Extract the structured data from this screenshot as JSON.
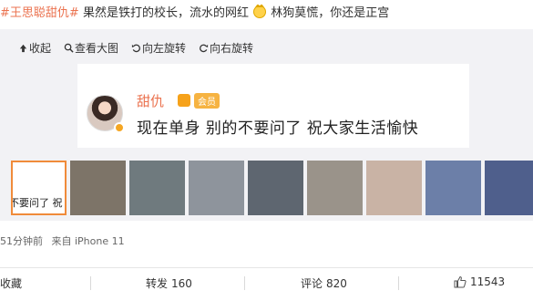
{
  "post": {
    "topic": "#王思聪甜仇#",
    "text_1": "果然是铁打的校长，流水的网红",
    "emoji_icon": "cat-emoji-icon",
    "text_2": "林狗莫慌，你还是正宫"
  },
  "toolbar": {
    "collapse": "收起",
    "view_large": "查看大图",
    "rotate_left": "向左旋转",
    "rotate_right": "向右旋转"
  },
  "image": {
    "user_name": "甜仇",
    "member_tag": "会员",
    "quote": "现在单身 别的不要问了 祝大家生活愉快"
  },
  "thumbnails": [
    {
      "label": "不要问了 祝",
      "selected": true,
      "tone": "#ffffff"
    },
    {
      "label": "",
      "selected": false,
      "tone": "#7d7468"
    },
    {
      "label": "",
      "selected": false,
      "tone": "#6f7a7e"
    },
    {
      "label": "",
      "selected": false,
      "tone": "#8e949c"
    },
    {
      "label": "",
      "selected": false,
      "tone": "#5e6670"
    },
    {
      "label": "",
      "selected": false,
      "tone": "#9a938a"
    },
    {
      "label": "",
      "selected": false,
      "tone": "#c9b3a5"
    },
    {
      "label": "",
      "selected": false,
      "tone": "#6c7fa8"
    },
    {
      "label": "",
      "selected": false,
      "tone": "#4f5f8c"
    }
  ],
  "meta": {
    "time": "51分钟前",
    "source": "来自 iPhone 11"
  },
  "actions": {
    "favorite": "收藏",
    "repost_label": "转发",
    "repost_count": "160",
    "comment_label": "评论",
    "comment_count": "820",
    "like_count": "11543"
  },
  "colors": {
    "accent": "#eb7350",
    "panel_bg": "#f2f2f5",
    "selected_border": "#f08b3a"
  }
}
